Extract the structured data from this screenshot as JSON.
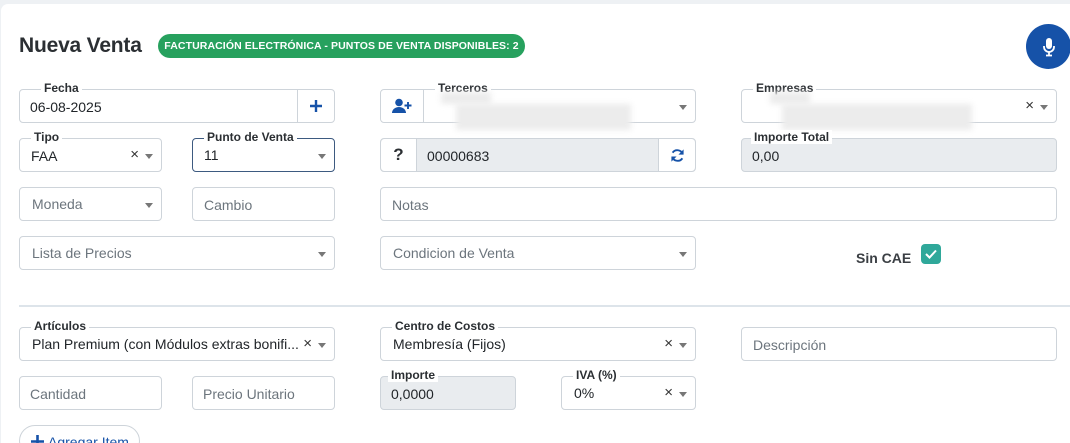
{
  "header": {
    "title": "Nueva Venta",
    "badge": "FACTURACIÓN ELECTRÓNICA - PUNTOS DE VENTA DISPONIBLES: 2"
  },
  "form": {
    "fecha": {
      "label": "Fecha",
      "value": "06-08-2025"
    },
    "terceros": {
      "label": "Terceros"
    },
    "empresas": {
      "label": "Empresas"
    },
    "tipo": {
      "label": "Tipo",
      "value": "FAA"
    },
    "punto_venta": {
      "label": "Punto de Venta",
      "value": "11"
    },
    "numero": {
      "value": "00000683"
    },
    "importe_total": {
      "label": "Importe Total",
      "value": "0,00"
    },
    "moneda": {
      "placeholder": "Moneda"
    },
    "cambio": {
      "placeholder": "Cambio"
    },
    "notas": {
      "placeholder": "Notas"
    },
    "lista_precios": {
      "placeholder": "Lista de Precios"
    },
    "condicion_venta": {
      "placeholder": "Condicion de Venta"
    },
    "sin_cae": {
      "label": "Sin CAE",
      "checked": true
    }
  },
  "item": {
    "articulos": {
      "label": "Artículos",
      "value": "Plan Premium (con Módulos extras bonifi..."
    },
    "centro_costos": {
      "label": "Centro de Costos",
      "value": "Membresía (Fijos)"
    },
    "descripcion": {
      "placeholder": "Descripción"
    },
    "cantidad": {
      "placeholder": "Cantidad"
    },
    "precio_unitario": {
      "placeholder": "Precio Unitario"
    },
    "importe": {
      "label": "Importe",
      "value": "0,0000"
    },
    "iva": {
      "label": "IVA (%)",
      "value": "0%"
    },
    "add_item_label": "Agregar Item"
  },
  "glyphs": {
    "clear": "×",
    "question": "?",
    "plus": "+"
  },
  "colors": {
    "primary": "#1652a8",
    "badge": "#27a15e",
    "checkbox": "#2fa89a"
  }
}
